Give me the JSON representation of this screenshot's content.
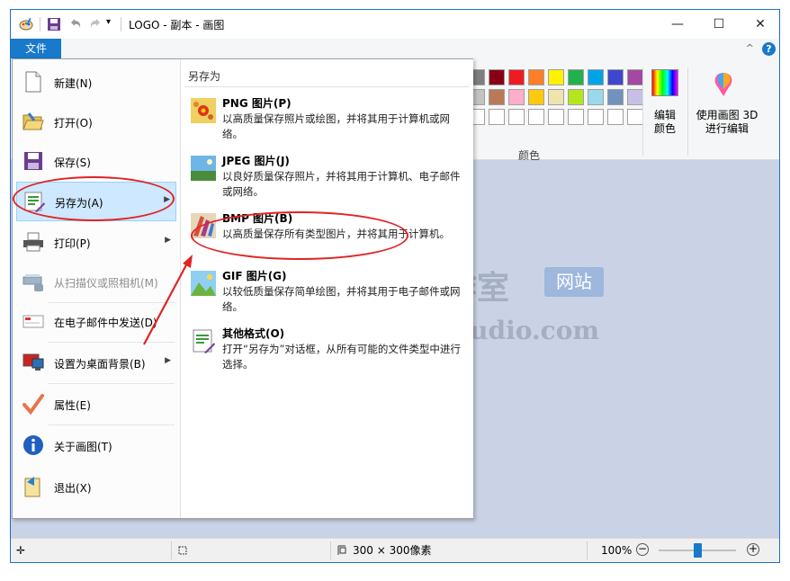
{
  "window": {
    "title": "LOGO - 副本 - 画图",
    "controls": [
      "—",
      "☐",
      "✕"
    ]
  },
  "ribbon": {
    "file_tab": "文件",
    "colors_group_label": "颜色",
    "edit_colors_label": "编辑颜色",
    "paint3d_label": "使用画图 3D 进行编辑",
    "help_glyph": "?",
    "collapse_glyph": "^",
    "palette_row1": [
      "#7f7f7f",
      "#880015",
      "#ed1c24",
      "#ff7f27",
      "#fff200",
      "#22b14c",
      "#00a2e8",
      "#3f48cc",
      "#a349a4"
    ],
    "palette_row2": [
      "#c3c3c3",
      "#b97a57",
      "#ffaec9",
      "#ffc90e",
      "#efe4b0",
      "#b5e61d",
      "#99d9ea",
      "#7092be",
      "#c8bfe7"
    ]
  },
  "file_menu": {
    "items": [
      {
        "label": "新建(N)",
        "icon": "new-file-icon"
      },
      {
        "label": "打开(O)",
        "icon": "open-folder-icon"
      },
      {
        "label": "保存(S)",
        "icon": "save-disk-icon"
      },
      {
        "label": "另存为(A)",
        "icon": "save-as-icon",
        "submenu": true
      },
      {
        "label": "打印(P)",
        "icon": "printer-icon",
        "submenu": true
      },
      {
        "label": "从扫描仪或照相机(M)",
        "icon": "scanner-icon",
        "disabled": true
      },
      {
        "label": "在电子邮件中发送(D)",
        "icon": "email-icon"
      },
      {
        "label": "设置为桌面背景(B)",
        "icon": "desktop-icon",
        "submenu": true
      },
      {
        "label": "属性(E)",
        "icon": "checkmark-icon"
      },
      {
        "label": "关于画图(T)",
        "icon": "info-icon"
      },
      {
        "label": "退出(X)",
        "icon": "exit-icon"
      }
    ]
  },
  "save_as_submenu": {
    "header": "另存为",
    "items": [
      {
        "title": "PNG 图片(P)",
        "desc": "以高质量保存照片或绘图，并将其用于计算机或网络。",
        "icon": "png-image-icon"
      },
      {
        "title": "JPEG 图片(J)",
        "desc": "以良好质量保存照片，并将其用于计算机、电子邮件或网络。",
        "icon": "jpeg-image-icon"
      },
      {
        "title": "BMP 图片(B)",
        "desc": "以高质量保存所有类型图片，并将其用于计算机。",
        "icon": "bmp-image-icon"
      },
      {
        "title": "GIF 图片(G)",
        "desc": "以较低质量保存简单绘图，并将其用于电子邮件或网络。",
        "icon": "gif-image-icon"
      },
      {
        "title": "其他格式(O)",
        "desc": "打开“另存为”对话框，从所有可能的文件类型中进行选择。",
        "icon": "other-format-icon"
      }
    ]
  },
  "watermark": {
    "cn": "腾龙工作室",
    "badge": "网站",
    "en": "Tenlonstudio.com"
  },
  "status": {
    "image_size": "300 × 300像素",
    "zoom": "100%",
    "zoom_level": 0.5
  }
}
